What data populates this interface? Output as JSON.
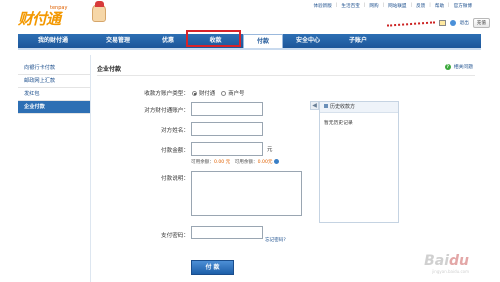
{
  "brand": {
    "logo_text": "财付通",
    "logo_sub": "tenpay"
  },
  "top_links": [
    "体验新版",
    "生活百宝",
    "网购",
    "网站联盟",
    "反馈",
    "帮助",
    "官方微博"
  ],
  "user": {
    "logout": "退出",
    "recharge": "充值"
  },
  "nav": {
    "items": [
      {
        "label": "我的财付通",
        "active": false
      },
      {
        "label": "交易管理",
        "active": false
      },
      {
        "label": "优惠",
        "active": false
      },
      {
        "label": "收款",
        "active": false
      },
      {
        "label": "付款",
        "active": true
      },
      {
        "label": "安全中心",
        "active": false
      },
      {
        "label": "子账户",
        "active": false
      }
    ]
  },
  "sidebar": {
    "items": [
      {
        "label": "向银行卡付款",
        "active": false
      },
      {
        "label": "邮政网上汇款",
        "active": false
      },
      {
        "label": "发红包",
        "active": false
      },
      {
        "label": "企业付款",
        "active": true
      }
    ]
  },
  "main": {
    "title": "企业付款",
    "help": "相关问题",
    "account_type_label": "收款方账户类型：",
    "account_type_options": [
      "财付通",
      "商户号"
    ],
    "account_label": "对方财付通账户：",
    "name_label": "对方姓名：",
    "amount_label": "付款金额：",
    "amount_unit": "元",
    "balance_text": "可用余额：",
    "balance_value": "0.00 元",
    "quota_text": "可用余额：",
    "quota_value": "0.00元",
    "note_label": "付款说明：",
    "password_label": "支付密码：",
    "forgot": "忘记密码?",
    "submit": "付 款"
  },
  "history": {
    "title": "历史收款方",
    "empty": "暂无历史记录"
  },
  "colors": {
    "nav_blue": "#1d5699",
    "highlight": "#d8232a",
    "accent_orange": "#e06000"
  }
}
